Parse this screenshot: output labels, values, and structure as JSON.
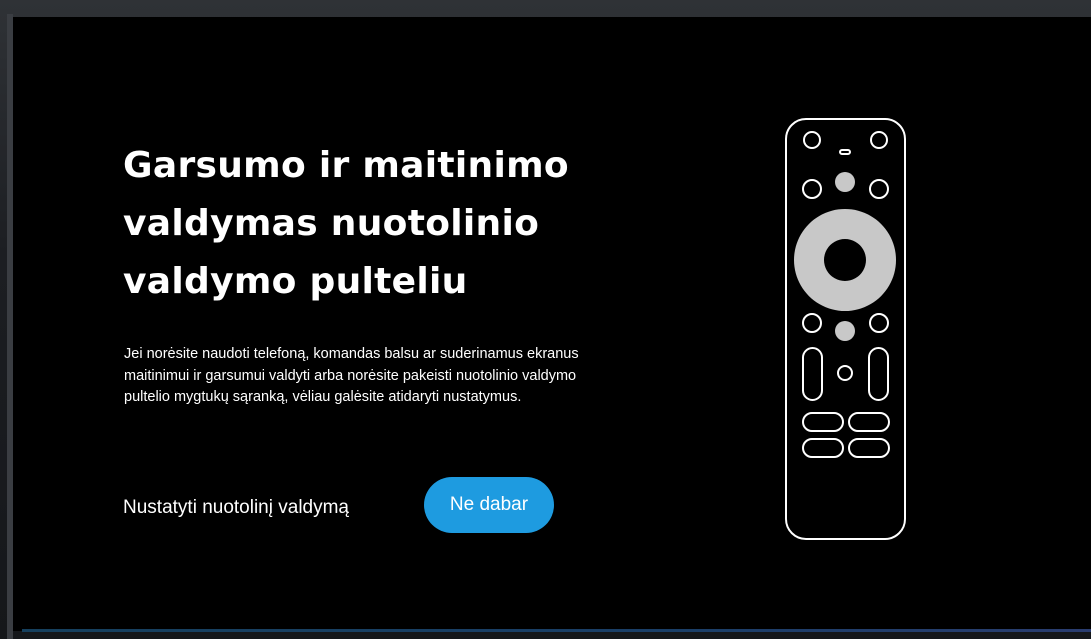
{
  "screen": {
    "title": "Garsumo ir maitinimo valdymas nuotolinio valdymo pulteliu",
    "description": "Jei norėsite naudoti telefoną, komandas balsu ar suderinamus ekranus maitinimui  ir garsumui valdyti arba norėsite pakeisti nuotolinio valdymo pultelio mygtukų sąranką, vėliau galėsite atidaryti nustatymus.",
    "actions": {
      "setup_label": "Nustatyti nuotolinį valdymą",
      "not_now_label": "Ne dabar"
    }
  },
  "colors": {
    "background": "#000000",
    "accent": "#1e9be0",
    "remote_outline": "#ffffff",
    "remote_fill": "#c8c8c8"
  },
  "icons": {
    "remote": "remote-control-illustration"
  }
}
